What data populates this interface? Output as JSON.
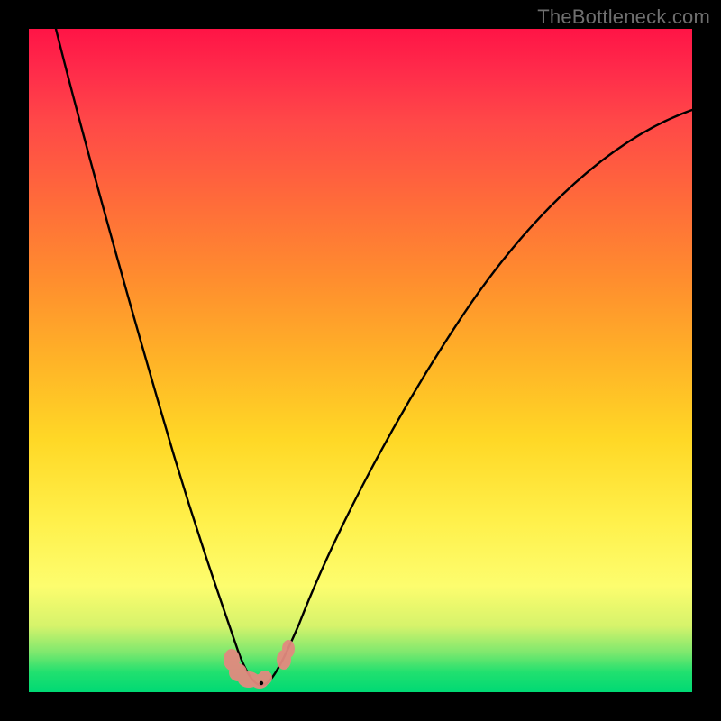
{
  "watermark": {
    "text": "TheBottleneck.com"
  },
  "chart_data": {
    "type": "line",
    "title": "",
    "xlabel": "",
    "ylabel": "",
    "xlim": [
      0,
      100
    ],
    "ylim": [
      0,
      100
    ],
    "grid": false,
    "legend": false,
    "series": [
      {
        "name": "bottleneck-curve",
        "x": [
          4,
          6,
          8,
          10,
          12,
          14,
          16,
          18,
          20,
          22,
          24,
          26,
          28,
          30,
          31,
          32,
          33,
          34,
          35,
          36,
          38,
          42,
          48,
          56,
          66,
          78,
          90,
          100
        ],
        "values": [
          100,
          92,
          84,
          76,
          68,
          60,
          52,
          44,
          36,
          28,
          21,
          15,
          10,
          6,
          4,
          3,
          2.5,
          2.5,
          3,
          4,
          6,
          12,
          20,
          32,
          46,
          60,
          72,
          80
        ]
      }
    ],
    "markers": [
      {
        "name": "low-cluster",
        "x_range": [
          28,
          32
        ],
        "y": 3,
        "color": "#e28a7f"
      },
      {
        "name": "high-cluster",
        "x_range": [
          36,
          38
        ],
        "y": 4,
        "color": "#e28a7f"
      }
    ],
    "gradient_stops_percent_to_color": {
      "0": "#ff1446",
      "25": "#ff7a34",
      "50": "#ffb327",
      "75": "#fff04a",
      "95": "#7ee86e",
      "100": "#00d974"
    }
  }
}
